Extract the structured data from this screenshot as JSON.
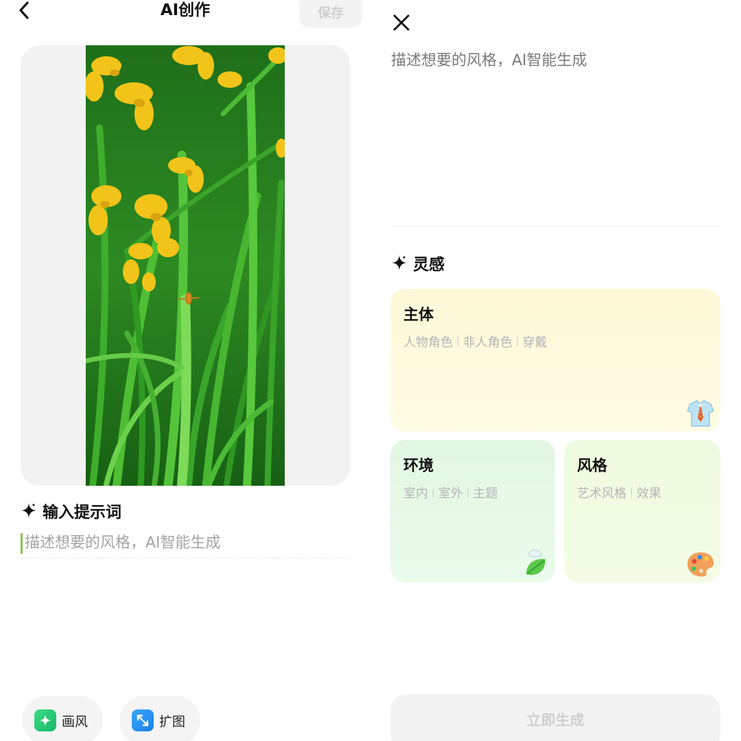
{
  "left": {
    "title": "AI创作",
    "save_label": "保存",
    "photo_icon": "iris-flower-photo",
    "prompt_heading": "输入提示词",
    "prompt_placeholder": "描述想要的风格，AI智能生成",
    "tools": [
      {
        "label": "画风",
        "icon": "sparkle-style-icon",
        "color": "#22c474"
      },
      {
        "label": "扩图",
        "icon": "expand-arrows-icon",
        "color": "#2b95f5"
      }
    ]
  },
  "right": {
    "input_placeholder": "描述想要的风格，AI智能生成",
    "inspiration_heading": "灵感",
    "cards": {
      "subject": {
        "title": "主体",
        "tags": [
          "人物角色",
          "非人角色",
          "穿戴"
        ],
        "icon": "shirt-tie-icon"
      },
      "environment": {
        "title": "环境",
        "tags": [
          "室内",
          "室外",
          "主题"
        ],
        "icon": "leaf-icon"
      },
      "style": {
        "title": "风格",
        "tags": [
          "艺术风格",
          "效果"
        ],
        "icon": "palette-icon"
      }
    },
    "generate_label": "立即生成"
  },
  "colors": {
    "accent_green": "#8bc34a",
    "disabled_text": "#cfcfcf",
    "subject_bg": "#fdf9d8",
    "environment_bg": "#e2f8e3",
    "style_bg": "#eefbe0"
  }
}
